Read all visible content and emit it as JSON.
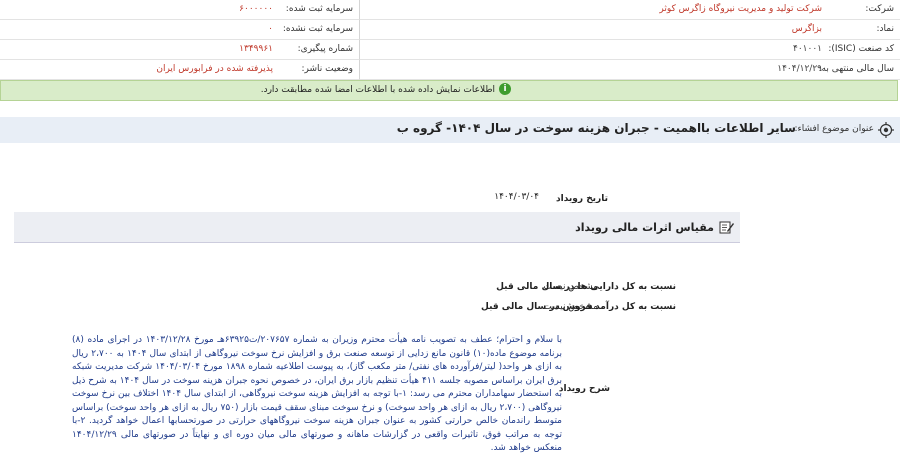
{
  "header": {
    "company_label": "شرکت:",
    "company_value": "شرکت تولید و مدیریت نیروگاه زاگرس کوثر",
    "symbol_label": "نماد:",
    "symbol_value": "بزاگرس",
    "isic_label": "کد صنعت (ISIC):",
    "isic_value": "۴۰۱۰۰۱",
    "fiscal_label": "سال مالی منتهی به:",
    "fiscal_value": "۱۴۰۴/۱۲/۲۹",
    "reg_capital_label": "سرمایه ثبت شده:",
    "reg_capital_value": "۶۰۰۰۰۰۰",
    "unreg_capital_label": "سرمایه ثبت نشده:",
    "unreg_capital_value": "۰",
    "tracking_label": "شماره پیگیری:",
    "tracking_value": "۱۳۴۹۹۶۱",
    "publisher_label": "وضعیت ناشر:",
    "publisher_value": "پذیرفته شده در فرابورس ایران"
  },
  "banner": {
    "icon": "info-icon",
    "text": "اطلاعات نمایش داده شده با اطلاعات امضا شده مطابقت دارد."
  },
  "subject": {
    "icon": "target-icon",
    "label": "عنوان موضوع افشاء:",
    "title": "سایر اطلاعات بااهمیت - جبران هزینه سوخت در سال ۱۴۰۴- گروه ب"
  },
  "event": {
    "date_label": "تاریخ رویداد",
    "date_value": "۱۴۰۴/۰۳/۰۴"
  },
  "section": {
    "icon": "pencil-note-icon",
    "title": "مقیاس اثرات مالی رویداد"
  },
  "fields": [
    {
      "label": "نسبت به کل دارایی ها در سال مالی قبل",
      "value": "مشخص نیست"
    },
    {
      "label": "نسبت به کل درآمد فروش در سال مالی قبل",
      "value": "مشخص نیست"
    }
  ],
  "description": {
    "label": "شرح رویداد",
    "text": "با سلام و احترام؛ عطف به تصویب نامه هیأت محترم وزیران به شماره ۲۰۷۶۵۷/ت۶۳۹۲۵هـ مورخ ۱۴۰۳/۱۲/۲۸ در اجرای ماده (۸) برنامه موضوع ماده(۱۰) قانون مانع زدایی از توسعه صنعت برق و افزایش نرخ سوخت نیروگاهی از ابتدای سال ۱۴۰۴ به ۲،۷۰۰ ریال به ازای هر واحد( لیتر/فرآورده های نفتی/ متر مکعب گاز)، به پیوست اطلاعیه شماره ۱۸۹۸ مورخ ۱۴۰۴/۰۳/۰۴ شرکت مدیریت شبکه برق ایران براساس مصوبه جلسه ۴۱۱ هیأت تنظیم بازار برق ایران، در خصوص نحوه جبران هزینه سوخت در سال ۱۴۰۴ به شرح ذیل به استحضار سهامداران محترم می رسد: ۱-با توجه به افزایش هزینه سوخت نیروگاهی، از ابتدای سال ۱۴۰۴ اختلاف بین نرخ سوخت نیروگاهی (۲،۷۰۰ ریال به ازای هر واحد سوخت) و نرخ سوخت مبنای سقف قیمت بازار (۷۵۰ ریال به ازای هر واحد سوخت) براساس متوسط راندمان خالص حرارتی کشور به عنوان جبران هزینه سوخت نیروگاههای حرارتی در صورتحسابها اعمال خواهد گردید. ۲-با توجه به مراتب فوق، تاثیرات واقعی در گزارشات ماهانه و صورتهای مالی میان دوره ای و نهایتاً در صورتهای مالی ۱۴۰۴/۱۲/۲۹ منعکس خواهد شد."
  }
}
